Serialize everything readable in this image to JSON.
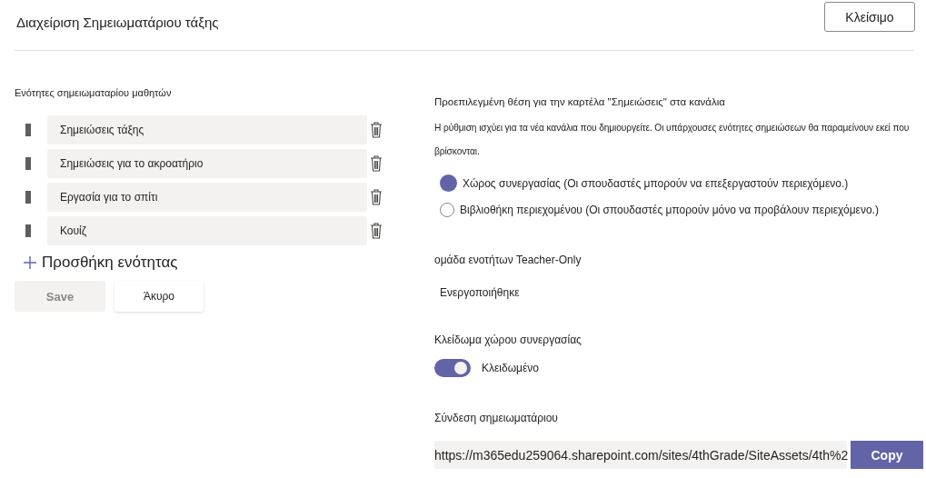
{
  "header": {
    "title": "Διαχείριση Σημειωματάριου τάξης",
    "close_button": "Κλείσιμο"
  },
  "sections": {
    "label": "Ενότητες σημειωματαρίου μαθητών",
    "items": [
      {
        "value": "Σημειώσεις τάξης"
      },
      {
        "value": "Σημειώσεις για το ακροατήριο"
      },
      {
        "value": "Εργασία για το σπίτι"
      },
      {
        "value": "Κουίζ"
      }
    ],
    "add_button": "Προσθήκη ενότητας",
    "save_button": {
      "label": "Save",
      "disabled": true
    },
    "cancel_button": "Άκυρο"
  },
  "default_location": {
    "label": "Προεπιλεγμένη θέση για την καρτέλα \"Σημειώσεις\" στα κανάλια",
    "description": "Η ρύθμιση ισχύει για τα νέα κανάλια που δημιουργείτε. Οι υπάρχουσες ενότητες σημειώσεων θα παραμείνουν εκεί που βρίσκονται.",
    "options": [
      {
        "label": "Χώρος συνεργασίας (Οι σπουδαστές μπορούν να επεξεργαστούν περιεχόμενο.)",
        "selected": true
      },
      {
        "label": "Βιβλιοθήκη περιεχομένου (Οι σπουδαστές μπορούν μόνο να προβάλουν περιεχόμενο.)",
        "selected": false
      }
    ]
  },
  "teacher_only": {
    "label": "ομάδα ενοτήτων Teacher-Only",
    "status": "Ενεργοποιήθηκε"
  },
  "lock": {
    "label": "Κλείδωμα χώρου συνεργασίας",
    "on": true,
    "state_label": "Κλειδωμένο"
  },
  "link": {
    "label": "Σύνδεση σημειωματάριου",
    "url": "https://m365edu259064.sharepoint.com/sites/4thGrade/SiteAssets/4th%2",
    "copy_button": "Copy"
  }
}
